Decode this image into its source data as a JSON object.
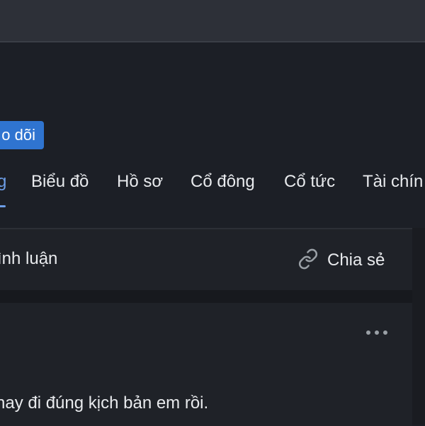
{
  "header": {
    "follow_label": "o dõi"
  },
  "tabs": [
    {
      "label": "g",
      "active": true
    },
    {
      "label": "Biểu đồ",
      "active": false
    },
    {
      "label": "Hồ sơ",
      "active": false
    },
    {
      "label": "Cổ đông",
      "active": false
    },
    {
      "label": "Cổ tức",
      "active": false
    },
    {
      "label": "Tài chín",
      "active": false
    }
  ],
  "actions": {
    "comment_label": "ình luận",
    "share_label": "Chia sẻ",
    "share_icon": "link-icon"
  },
  "post": {
    "more_icon": "more-horizontal-icon",
    "text": "nay đi đúng kịch bản em rồi."
  },
  "colors": {
    "accent": "#2f74d0",
    "active_tab": "#6d9ee8",
    "background": "#1c1f26",
    "top_bar": "#2d3038"
  }
}
